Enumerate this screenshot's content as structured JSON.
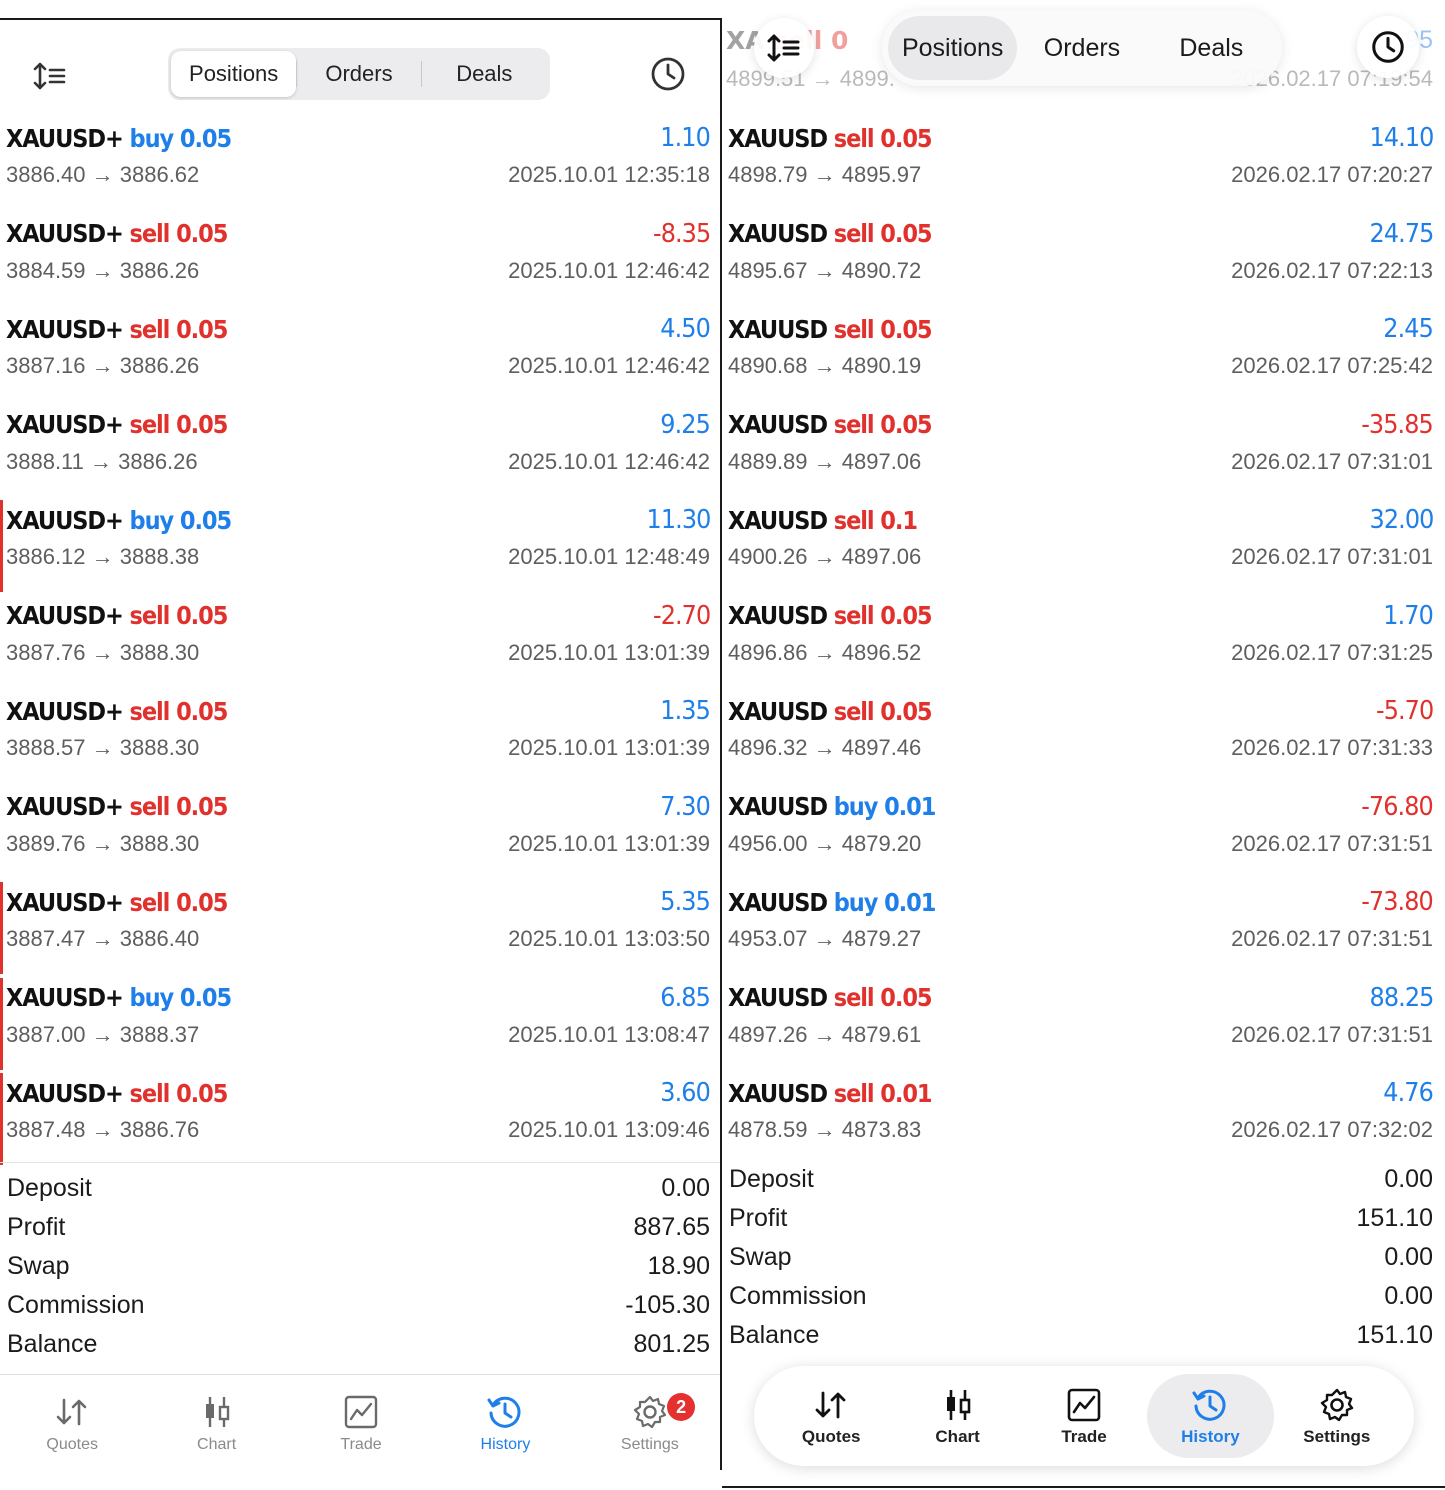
{
  "colors": {
    "buy": "#1f7fe8",
    "sell": "#e0312d",
    "accent": "#1f7fe8",
    "badge": "#e53030"
  },
  "left": {
    "tabs": [
      {
        "label": "Positions",
        "active": true
      },
      {
        "label": "Orders",
        "active": false
      },
      {
        "label": "Deals",
        "active": false
      }
    ],
    "icons": {
      "sort": "sort-icon",
      "history": "clock-icon"
    },
    "rows": [
      {
        "symbol": "XAUUSD+",
        "side": "buy",
        "volume": "0.05",
        "profit": "1.10",
        "profit_sign": "pos",
        "prices": "3886.40 → 3886.62",
        "time": "2025.10.01 12:35:18",
        "marked": false
      },
      {
        "symbol": "XAUUSD+",
        "side": "sell",
        "volume": "0.05",
        "profit": "-8.35",
        "profit_sign": "neg",
        "prices": "3884.59 → 3886.26",
        "time": "2025.10.01 12:46:42",
        "marked": false
      },
      {
        "symbol": "XAUUSD+",
        "side": "sell",
        "volume": "0.05",
        "profit": "4.50",
        "profit_sign": "pos",
        "prices": "3887.16 → 3886.26",
        "time": "2025.10.01 12:46:42",
        "marked": false
      },
      {
        "symbol": "XAUUSD+",
        "side": "sell",
        "volume": "0.05",
        "profit": "9.25",
        "profit_sign": "pos",
        "prices": "3888.11 → 3886.26",
        "time": "2025.10.01 12:46:42",
        "marked": false
      },
      {
        "symbol": "XAUUSD+",
        "side": "buy",
        "volume": "0.05",
        "profit": "11.30",
        "profit_sign": "pos",
        "prices": "3886.12 → 3888.38",
        "time": "2025.10.01 12:48:49",
        "marked": true
      },
      {
        "symbol": "XAUUSD+",
        "side": "sell",
        "volume": "0.05",
        "profit": "-2.70",
        "profit_sign": "neg",
        "prices": "3887.76 → 3888.30",
        "time": "2025.10.01 13:01:39",
        "marked": false
      },
      {
        "symbol": "XAUUSD+",
        "side": "sell",
        "volume": "0.05",
        "profit": "1.35",
        "profit_sign": "pos",
        "prices": "3888.57 → 3888.30",
        "time": "2025.10.01 13:01:39",
        "marked": false
      },
      {
        "symbol": "XAUUSD+",
        "side": "sell",
        "volume": "0.05",
        "profit": "7.30",
        "profit_sign": "pos",
        "prices": "3889.76 → 3888.30",
        "time": "2025.10.01 13:01:39",
        "marked": false
      },
      {
        "symbol": "XAUUSD+",
        "side": "sell",
        "volume": "0.05",
        "profit": "5.35",
        "profit_sign": "pos",
        "prices": "3887.47 → 3886.40",
        "time": "2025.10.01 13:03:50",
        "marked": true
      },
      {
        "symbol": "XAUUSD+",
        "side": "buy",
        "volume": "0.05",
        "profit": "6.85",
        "profit_sign": "pos",
        "prices": "3887.00 → 3888.37",
        "time": "2025.10.01 13:08:47",
        "marked": true
      },
      {
        "symbol": "XAUUSD+",
        "side": "sell",
        "volume": "0.05",
        "profit": "3.60",
        "profit_sign": "pos",
        "prices": "3887.48 → 3886.76",
        "time": "2025.10.01 13:09:46",
        "marked": true
      }
    ],
    "summary": [
      {
        "label": "Deposit",
        "value": "0.00"
      },
      {
        "label": "Profit",
        "value": "887.65"
      },
      {
        "label": "Swap",
        "value": "18.90"
      },
      {
        "label": "Commission",
        "value": "-105.30"
      },
      {
        "label": "Balance",
        "value": "801.25"
      }
    ],
    "nav": [
      {
        "label": "Quotes",
        "icon": "quotes-icon",
        "active": false
      },
      {
        "label": "Chart",
        "icon": "chart-icon",
        "active": false
      },
      {
        "label": "Trade",
        "icon": "trade-icon",
        "active": false
      },
      {
        "label": "History",
        "icon": "history-icon",
        "active": true
      },
      {
        "label": "Settings",
        "icon": "settings-icon",
        "active": false,
        "badge": "2"
      }
    ]
  },
  "right": {
    "tabs": [
      {
        "label": "Positions",
        "active": true
      },
      {
        "label": "Orders",
        "active": false
      },
      {
        "label": "Deals",
        "active": false
      }
    ],
    "icons": {
      "sort": "sort-icon",
      "history": "clock-icon"
    },
    "ghost": {
      "symbol": "XA",
      "side_volume": "sell 0",
      "profit": "95",
      "prices": "4899.51 → 4899.",
      "time": "2026.02.17 07:19:54"
    },
    "rows": [
      {
        "symbol": "XAUUSD",
        "side": "sell",
        "volume": "0.05",
        "profit": "14.10",
        "profit_sign": "pos",
        "prices": "4898.79 → 4895.97",
        "time": "2026.02.17 07:20:27"
      },
      {
        "symbol": "XAUUSD",
        "side": "sell",
        "volume": "0.05",
        "profit": "24.75",
        "profit_sign": "pos",
        "prices": "4895.67 → 4890.72",
        "time": "2026.02.17 07:22:13"
      },
      {
        "symbol": "XAUUSD",
        "side": "sell",
        "volume": "0.05",
        "profit": "2.45",
        "profit_sign": "pos",
        "prices": "4890.68 → 4890.19",
        "time": "2026.02.17 07:25:42"
      },
      {
        "symbol": "XAUUSD",
        "side": "sell",
        "volume": "0.05",
        "profit": "-35.85",
        "profit_sign": "neg",
        "prices": "4889.89 → 4897.06",
        "time": "2026.02.17 07:31:01"
      },
      {
        "symbol": "XAUUSD",
        "side": "sell",
        "volume": "0.1",
        "profit": "32.00",
        "profit_sign": "pos",
        "prices": "4900.26 → 4897.06",
        "time": "2026.02.17 07:31:01"
      },
      {
        "symbol": "XAUUSD",
        "side": "sell",
        "volume": "0.05",
        "profit": "1.70",
        "profit_sign": "pos",
        "prices": "4896.86 → 4896.52",
        "time": "2026.02.17 07:31:25"
      },
      {
        "symbol": "XAUUSD",
        "side": "sell",
        "volume": "0.05",
        "profit": "-5.70",
        "profit_sign": "neg",
        "prices": "4896.32 → 4897.46",
        "time": "2026.02.17 07:31:33"
      },
      {
        "symbol": "XAUUSD",
        "side": "buy",
        "volume": "0.01",
        "profit": "-76.80",
        "profit_sign": "neg",
        "prices": "4956.00 → 4879.20",
        "time": "2026.02.17 07:31:51"
      },
      {
        "symbol": "XAUUSD",
        "side": "buy",
        "volume": "0.01",
        "profit": "-73.80",
        "profit_sign": "neg",
        "prices": "4953.07 → 4879.27",
        "time": "2026.02.17 07:31:51"
      },
      {
        "symbol": "XAUUSD",
        "side": "sell",
        "volume": "0.05",
        "profit": "88.25",
        "profit_sign": "pos",
        "prices": "4897.26 → 4879.61",
        "time": "2026.02.17 07:31:51"
      },
      {
        "symbol": "XAUUSD",
        "side": "sell",
        "volume": "0.01",
        "profit": "4.76",
        "profit_sign": "pos",
        "prices": "4878.59 → 4873.83",
        "time": "2026.02.17 07:32:02"
      }
    ],
    "summary": [
      {
        "label": "Deposit",
        "value": "0.00"
      },
      {
        "label": "Profit",
        "value": "151.10"
      },
      {
        "label": "Swap",
        "value": "0.00"
      },
      {
        "label": "Commission",
        "value": "0.00"
      },
      {
        "label": "Balance",
        "value": "151.10"
      }
    ],
    "nav": [
      {
        "label": "Quotes",
        "icon": "quotes-icon",
        "active": false
      },
      {
        "label": "Chart",
        "icon": "chart-icon",
        "active": false
      },
      {
        "label": "Trade",
        "icon": "trade-icon",
        "active": false
      },
      {
        "label": "History",
        "icon": "history-icon",
        "active": true
      },
      {
        "label": "Settings",
        "icon": "settings-icon",
        "active": false
      }
    ]
  }
}
